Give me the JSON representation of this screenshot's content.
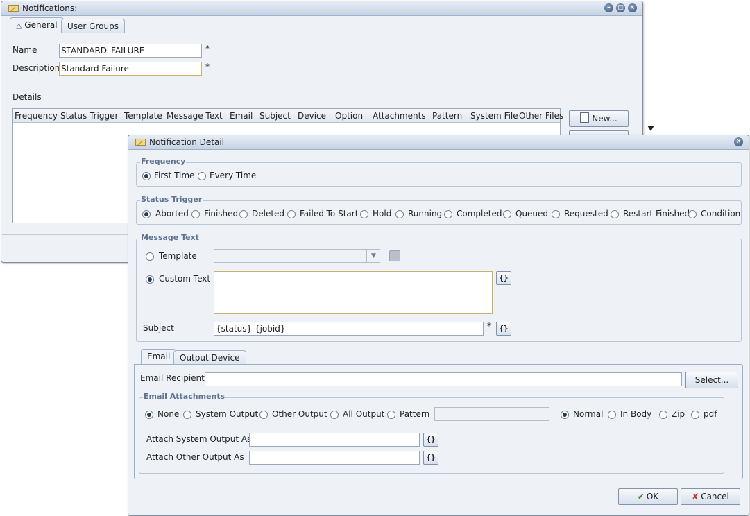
{
  "notifications": {
    "title": "Notifications:",
    "tabs": [
      {
        "label": "General"
      },
      {
        "label": "User Groups"
      }
    ],
    "name_label": "Name",
    "name_value": "STANDARD_FAILURE",
    "description_label": "Description",
    "description_value": "Standard Failure",
    "required_mark": "*",
    "details_label": "Details",
    "columns": [
      "Frequency",
      "Status Trigger",
      "Template",
      "Message Text",
      "Email",
      "Subject",
      "Device",
      "Option",
      "Attachments",
      "Pattern",
      "System File",
      "Other Files"
    ],
    "new_button": "New..."
  },
  "detail": {
    "title": "Notification Detail",
    "frequency": {
      "legend": "Frequency",
      "options": [
        {
          "label": "First Time",
          "selected": true
        },
        {
          "label": "Every Time",
          "selected": false
        }
      ]
    },
    "status_trigger": {
      "legend": "Status Trigger",
      "options": [
        {
          "label": "Aborted",
          "selected": true
        },
        {
          "label": "Finished",
          "selected": false
        },
        {
          "label": "Deleted",
          "selected": false
        },
        {
          "label": "Failed To Start",
          "selected": false
        },
        {
          "label": "Hold",
          "selected": false
        },
        {
          "label": "Running",
          "selected": false
        },
        {
          "label": "Completed",
          "selected": false
        },
        {
          "label": "Queued",
          "selected": false
        },
        {
          "label": "Requested",
          "selected": false
        },
        {
          "label": "Restart Finished",
          "selected": false
        },
        {
          "label": "Condition",
          "selected": false
        }
      ]
    },
    "message_text": {
      "legend": "Message Text",
      "template_label": "Template",
      "template_value": "",
      "custom_text_label": "Custom Text",
      "custom_text_value": "",
      "subject_label": "Subject",
      "subject_value": "{status} {jobid}",
      "required_mark": "*",
      "var_button": "{}"
    },
    "tabs": [
      {
        "label": "Email"
      },
      {
        "label": "Output Device"
      }
    ],
    "email": {
      "recipients_label": "Email Recipients",
      "recipients_value": "",
      "select_button": "Select...",
      "attachments": {
        "legend": "Email Attachments",
        "output_options": [
          {
            "label": "None",
            "selected": true
          },
          {
            "label": "System Output",
            "selected": false
          },
          {
            "label": "Other Output",
            "selected": false
          },
          {
            "label": "All Output",
            "selected": false
          },
          {
            "label": "Pattern",
            "selected": false
          }
        ],
        "pattern_value": "",
        "format_options": [
          {
            "label": "Normal",
            "selected": true
          },
          {
            "label": "In Body",
            "selected": false
          },
          {
            "label": "Zip",
            "selected": false
          },
          {
            "label": "pdf",
            "selected": false
          }
        ],
        "system_output_label": "Attach System Output As",
        "system_output_value": "",
        "other_output_label": "Attach Other Output As",
        "other_output_value": ""
      }
    },
    "ok_button": "OK",
    "cancel_button": "Cancel"
  }
}
